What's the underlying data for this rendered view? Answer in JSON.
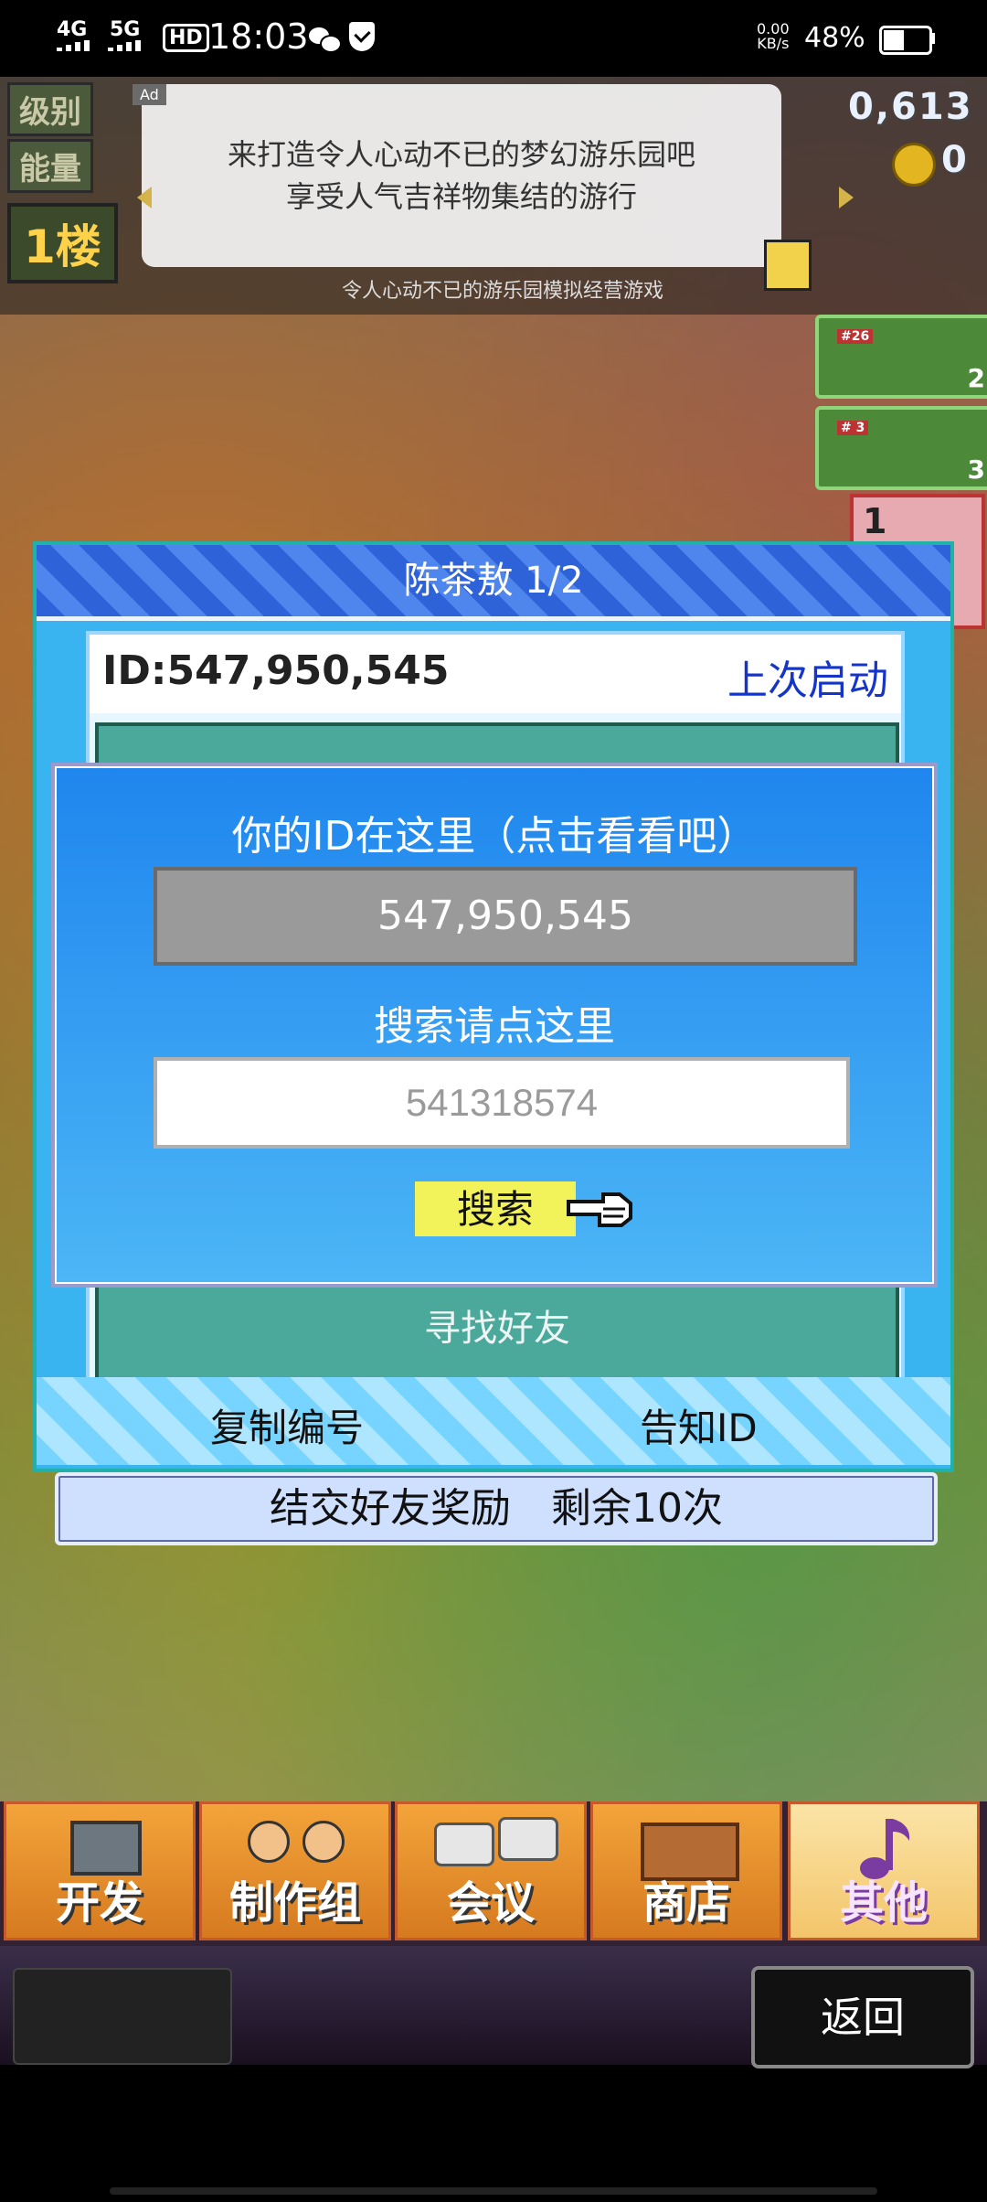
{
  "status_bar": {
    "signal_left": "4G",
    "signal_right": "5G",
    "hd_label": "HD",
    "time": "18:03",
    "net_speed": "0.00\nKB/s",
    "battery_percent": "48%"
  },
  "hud": {
    "level_label": "级别",
    "energy_label": "能量",
    "floor_label": "1楼",
    "counter": "0,613",
    "coins": "0"
  },
  "ad": {
    "tag": "Ad",
    "line1": "来打造令人心动不已的梦幻游乐园吧",
    "line2": "享受人气吉祥物集结的游行",
    "caption": "令人心动不已的游乐园模拟经营游戏"
  },
  "side_tiles": {
    "tile1_tag": "#26",
    "tile1_count": "2",
    "tile2_tag": "# 3",
    "tile2_count": "3",
    "tile3_count": "1"
  },
  "panel": {
    "title": "陈茶敖 1/2",
    "id_text": "ID:547,950,545",
    "last_launch": "上次启动",
    "friend_bottom": "寻找好友",
    "copy_btn": "复制编号",
    "tell_btn": "告知ID"
  },
  "reward_bar": "结交好友奖励　剩余10次",
  "popup": {
    "title": "你的ID在这里（点击看看吧）",
    "your_id": "547,950,545",
    "search_label": "搜索请点这里",
    "search_value": "541318574",
    "search_btn": "搜索"
  },
  "tabs": [
    {
      "label": "开发"
    },
    {
      "label": "制作组"
    },
    {
      "label": "会议"
    },
    {
      "label": "商店"
    },
    {
      "label": "其他"
    }
  ],
  "back_btn": "返回",
  "colors": {
    "popup_bg": "#1f86ee",
    "panel_bg": "#3ab4f0",
    "search_btn": "#f2f35a",
    "link_blue": "#1535c9"
  }
}
